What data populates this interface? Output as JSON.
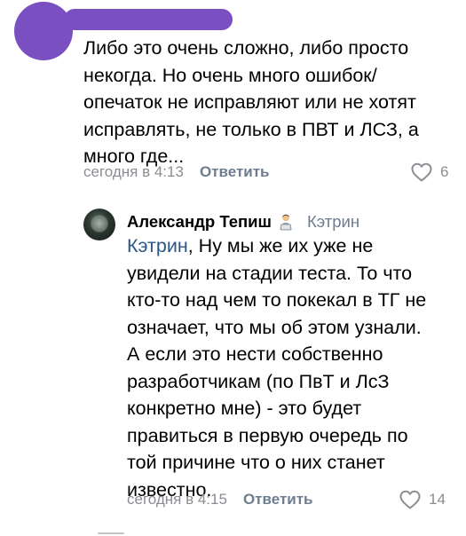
{
  "comment1": {
    "text": "Либо это очень сложно, либо просто\nнекогда. Но очень много ошибок/\nопечаток не исправляют или не хотят\nисправлять, не только в ПВТ и ЛСЗ, а\nмного где...",
    "time": "сегодня в 4:13",
    "reply_label": "Ответить",
    "likes": "6"
  },
  "comment2": {
    "author": "Александр Тепиш",
    "reply_to": "Кэтрин",
    "mention": "Кэтрин",
    "text_after_mention": ", Ну мы же их уже не\nувидели на стадии теста. То что\nкто-то над чем то покекал в ТГ не\nозначает, что мы об этом узнали.\nА если это нести собственно\nразработчикам (по ПвТ и ЛсЗ\nконкретно мне) - это будет\nправиться в первую очередь по\nтой причине что о них станет\nизвестно.",
    "time": "сегодня в 4:15",
    "reply_label": "Ответить",
    "likes": "14"
  },
  "colors": {
    "redaction": "#7a4fc1",
    "meta_gray": "#8a8d92",
    "reply_blue": "#6d7d8f",
    "mention_blue": "#2a5885"
  },
  "icons": {
    "like": "heart-outline-icon",
    "author_badge": "technologist-emoji-icon"
  }
}
